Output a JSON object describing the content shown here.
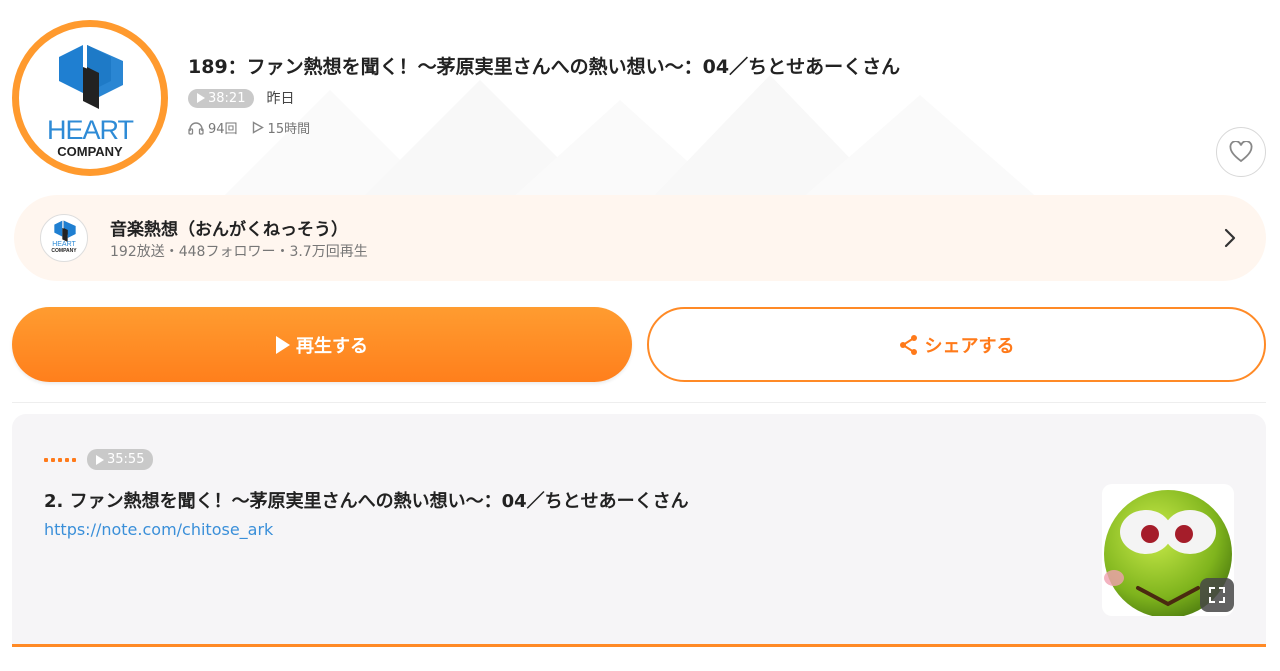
{
  "episode": {
    "title": "189：ファン熱想を聞く！〜茅原実里さんへの熱い想い〜：04／ちとせあーくさん",
    "duration": "38:21",
    "date": "昨日",
    "plays": "94回",
    "play_time": "15時間"
  },
  "cover": {
    "brand_top": "HEART",
    "brand_bottom": "COMPANY",
    "ring_color": "#ff9a2e"
  },
  "channel": {
    "name": "音楽熱想（おんがくねっそう）",
    "stats": "192放送・448フォロワー・3.7万回再生",
    "avatar_brand_top": "HEART",
    "avatar_brand_bottom": "COMPANY"
  },
  "actions": {
    "play_label": "再生する",
    "share_label": "シェアする"
  },
  "description": {
    "duration": "35:55",
    "title": "2. ファン熱想を聞く！〜茅原実里さんへの熱い想い〜：04／ちとせあーくさん",
    "link": "https://note.com/chitose_ark"
  },
  "colors": {
    "accent": "#ff8a26",
    "link": "#3a8fd9",
    "channel_bg": "#fff6ef",
    "card_bg": "#f6f5f7"
  },
  "icons": {
    "headphones": "headphones-icon",
    "play_count": "play-outline-icon",
    "heart": "heart-icon",
    "chevron": "chevron-right-icon",
    "share": "share-icon",
    "expand": "expand-icon"
  }
}
